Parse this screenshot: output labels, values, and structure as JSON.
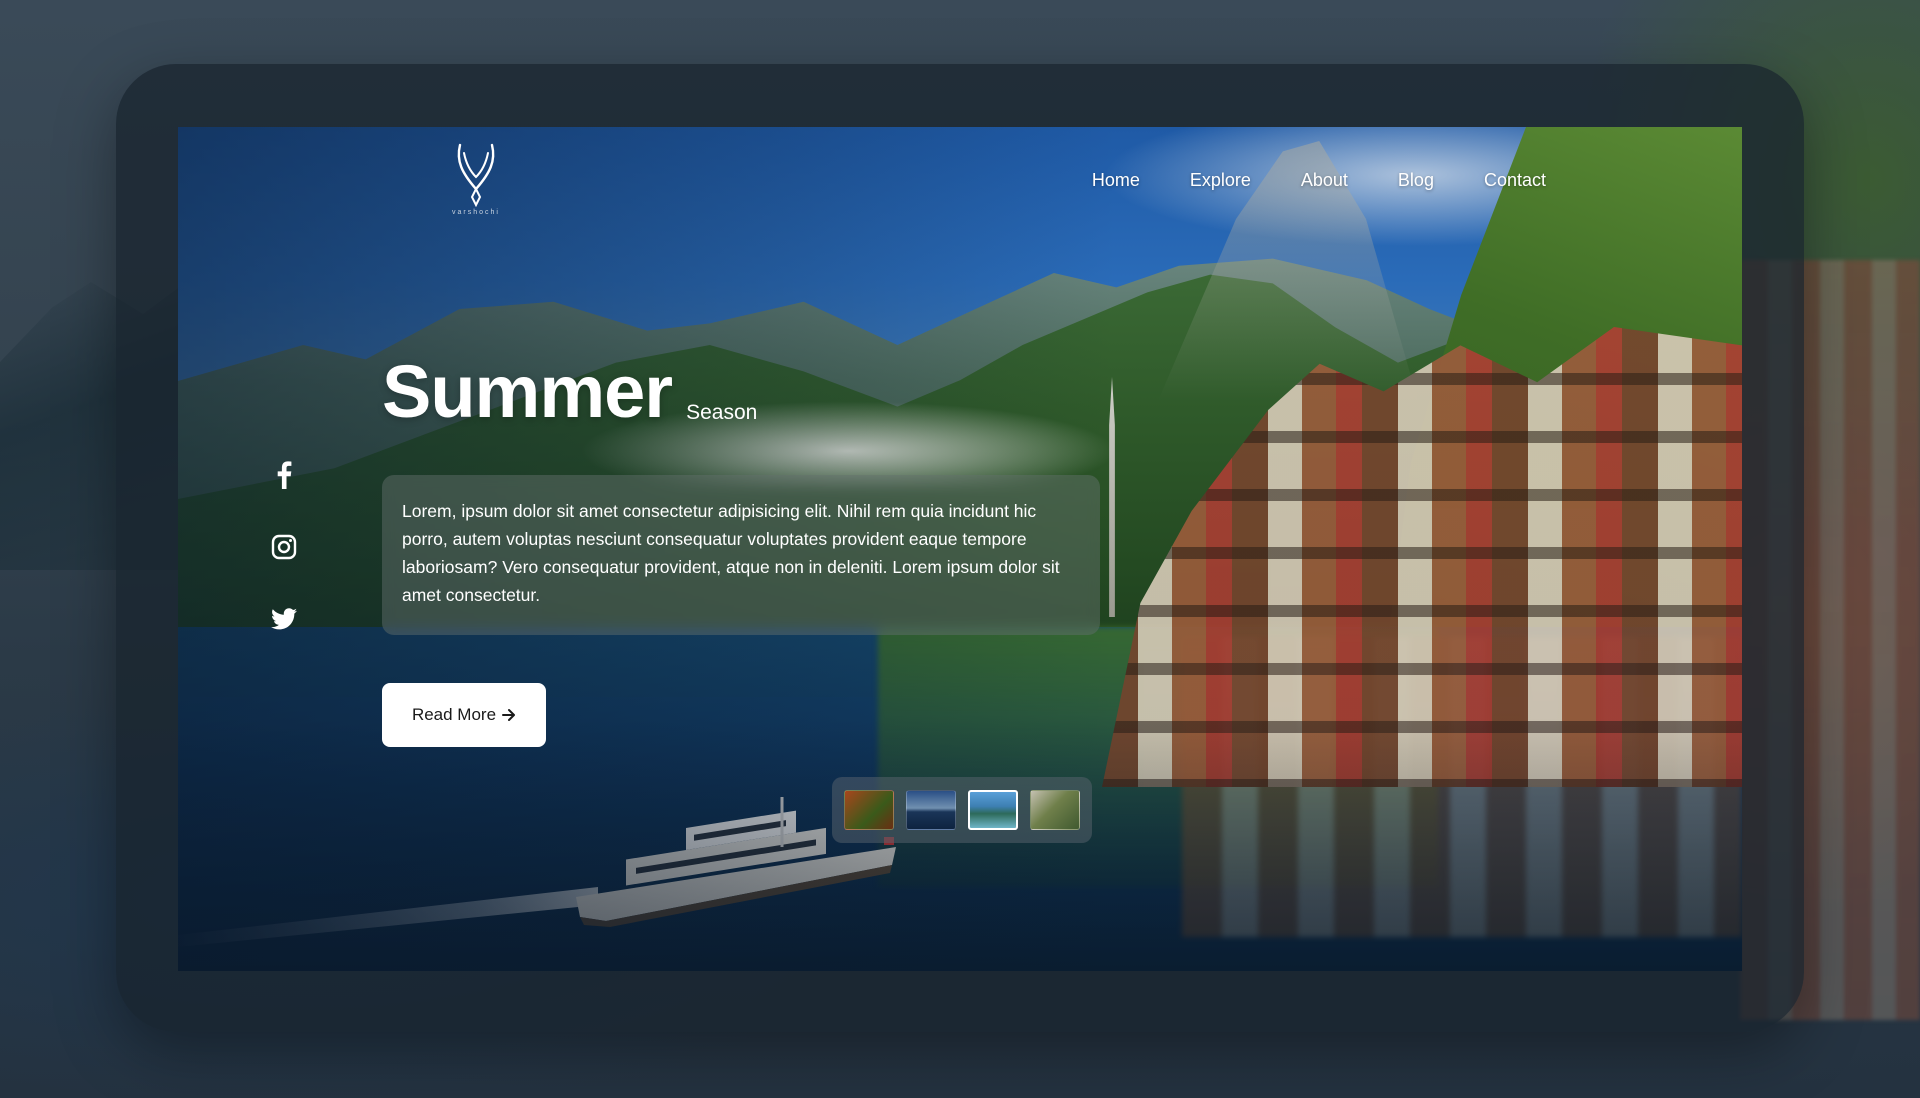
{
  "brand": {
    "logo_text": "varshochi",
    "logo_icon": "antler-icon"
  },
  "nav": {
    "items": [
      {
        "label": "Home"
      },
      {
        "label": "Explore"
      },
      {
        "label": "About"
      },
      {
        "label": "Blog"
      },
      {
        "label": "Contact"
      }
    ]
  },
  "hero": {
    "title": "Summer",
    "subtitle": "Season",
    "description": "Lorem, ipsum dolor sit amet consectetur adipisicing elit. Nihil rem quia incidunt hic porro, autem voluptas nesciunt consequatur voluptates provident eaque tempore laboriosam? Vero consequatur provident, atque non in deleniti. Lorem ipsum dolor sit amet consectetur.",
    "cta_label": "Read More",
    "cta_icon": "arrow-right-icon"
  },
  "socials": [
    {
      "name": "facebook",
      "icon": "facebook-icon"
    },
    {
      "name": "instagram",
      "icon": "instagram-icon"
    },
    {
      "name": "twitter",
      "icon": "twitter-icon"
    }
  ],
  "thumbnails": {
    "count": 4,
    "selected_index": 2
  },
  "colors": {
    "text": "#ffffff",
    "button_bg": "#ffffff",
    "button_text": "#1a1a1a",
    "frame": "#18222c"
  }
}
